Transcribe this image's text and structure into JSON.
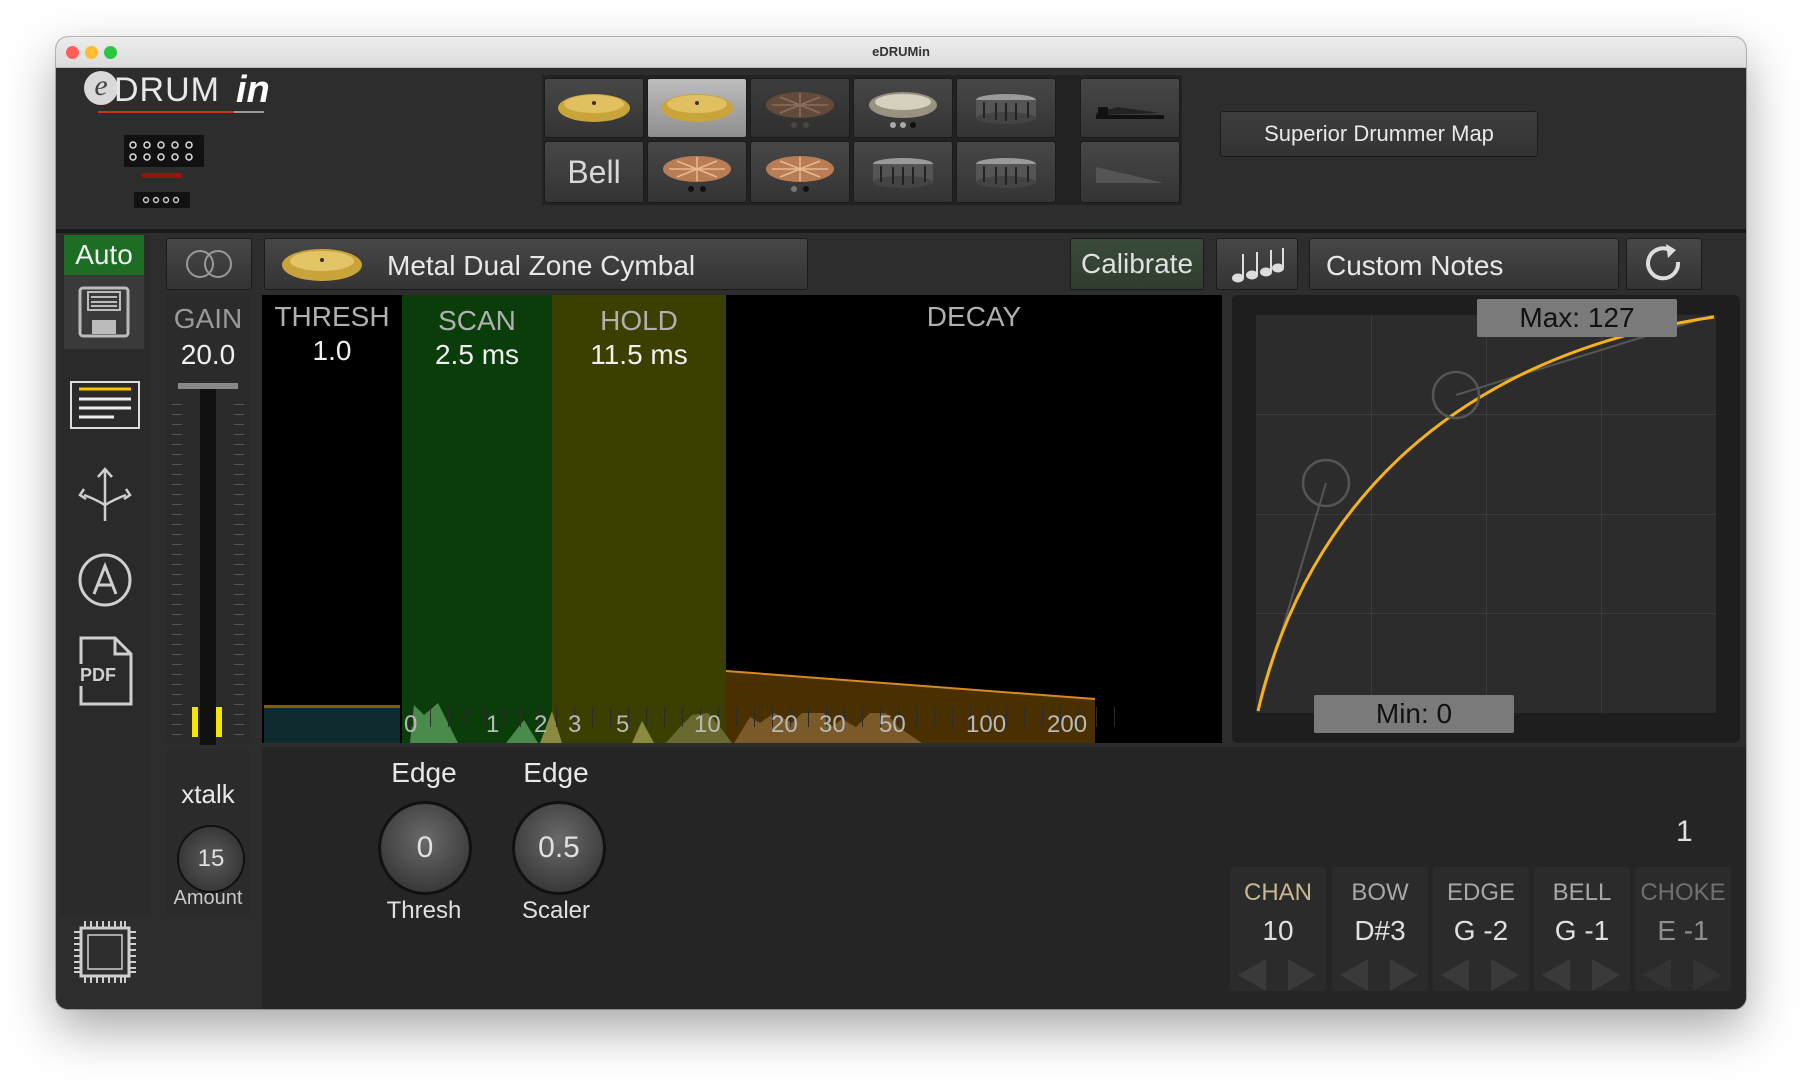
{
  "window": {
    "title": "eDRUMin"
  },
  "logo": {
    "e": "e",
    "drum": "DRUM",
    "in": "in"
  },
  "header": {
    "pad_bell_label": "Bell",
    "map_button": "Superior Drummer Map"
  },
  "toolbar": {
    "auto_label": "Auto",
    "instrument_name": "Metal Dual Zone Cymbal",
    "calibrate_label": "Calibrate",
    "custom_notes_label": "Custom Notes"
  },
  "gain": {
    "label": "GAIN",
    "value": "20.0"
  },
  "xtalk": {
    "label": "xtalk",
    "value": "15",
    "sub": "Amount"
  },
  "zones": {
    "thresh_label": "THRESH",
    "thresh_value": "1.0",
    "scan_label": "SCAN",
    "scan_value": "2.5 ms",
    "hold_label": "HOLD",
    "hold_value": "11.5 ms",
    "decay_label": "DECAY"
  },
  "scale_ticks": [
    "0",
    "1",
    "2",
    "3",
    "5",
    "10",
    "20",
    "30",
    "50",
    "100",
    "200"
  ],
  "curve": {
    "max_label": "Max: 127",
    "min_label": "Min: 0"
  },
  "knobs": [
    {
      "title": "Edge",
      "value": "0",
      "sub": "Thresh"
    },
    {
      "title": "Edge",
      "value": "0.5",
      "sub": "Scaler"
    }
  ],
  "page_number": "1",
  "notes": [
    {
      "header": "CHAN",
      "value": "10"
    },
    {
      "header": "BOW",
      "value": "D#3"
    },
    {
      "header": "EDGE",
      "value": "G -2"
    },
    {
      "header": "BELL",
      "value": "G -1"
    },
    {
      "header": "CHOKE",
      "value": "E -1"
    }
  ],
  "colors": {
    "accent": "#f5b21a",
    "scan": "#0a3d0a",
    "hold": "#3b3f00",
    "auto": "#1e6d24"
  }
}
